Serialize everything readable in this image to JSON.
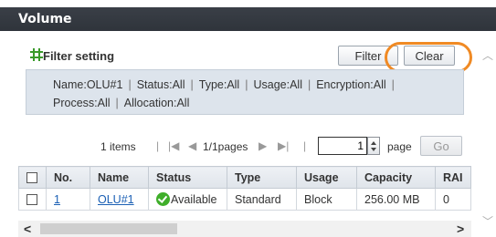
{
  "window": {
    "title": "Volume"
  },
  "filter": {
    "heading": "Filter setting",
    "icon": "filter-grid-icon",
    "filter_button": "Filter",
    "clear_button": "Clear",
    "highlight_color": "#f08a24",
    "criteria": {
      "name": "Name:OLU#1",
      "status": "Status:All",
      "type": "Type:All",
      "usage": "Usage:All",
      "encryption": "Encryption:All",
      "process": "Process:All",
      "allocation": "Allocation:All"
    }
  },
  "pager": {
    "items": "1 items",
    "pages": "1/1pages",
    "page_input": "1",
    "page_label": "page",
    "go_button": "Go"
  },
  "table": {
    "columns": [
      "No.",
      "Name",
      "Status",
      "Type",
      "Usage",
      "Capacity",
      "RAI"
    ],
    "rows": [
      {
        "no": "1",
        "name": "OLU#1",
        "status": "Available",
        "type": "Standard",
        "usage": "Block",
        "capacity": "256.00 MB",
        "raid": "0"
      }
    ]
  },
  "icons": {
    "status_ok": "check-circle-icon",
    "first": "first-page-icon",
    "prev": "prev-page-icon",
    "next": "next-page-icon",
    "last": "last-page-icon"
  },
  "colors": {
    "titlebar": "#2f343b",
    "criteria_bg": "#dde4ec",
    "link": "#1a5fb4",
    "ok_green": "#3fae2a"
  }
}
